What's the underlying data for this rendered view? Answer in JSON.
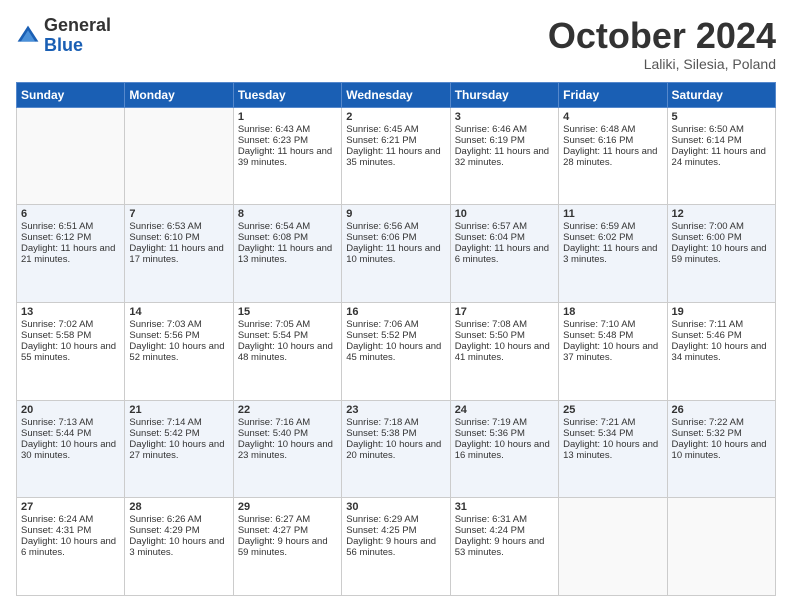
{
  "logo": {
    "general": "General",
    "blue": "Blue"
  },
  "header": {
    "month": "October 2024",
    "location": "Laliki, Silesia, Poland"
  },
  "weekdays": [
    "Sunday",
    "Monday",
    "Tuesday",
    "Wednesday",
    "Thursday",
    "Friday",
    "Saturday"
  ],
  "weeks": [
    [
      {
        "day": "",
        "sunrise": "",
        "sunset": "",
        "daylight": ""
      },
      {
        "day": "",
        "sunrise": "",
        "sunset": "",
        "daylight": ""
      },
      {
        "day": "1",
        "sunrise": "Sunrise: 6:43 AM",
        "sunset": "Sunset: 6:23 PM",
        "daylight": "Daylight: 11 hours and 39 minutes."
      },
      {
        "day": "2",
        "sunrise": "Sunrise: 6:45 AM",
        "sunset": "Sunset: 6:21 PM",
        "daylight": "Daylight: 11 hours and 35 minutes."
      },
      {
        "day": "3",
        "sunrise": "Sunrise: 6:46 AM",
        "sunset": "Sunset: 6:19 PM",
        "daylight": "Daylight: 11 hours and 32 minutes."
      },
      {
        "day": "4",
        "sunrise": "Sunrise: 6:48 AM",
        "sunset": "Sunset: 6:16 PM",
        "daylight": "Daylight: 11 hours and 28 minutes."
      },
      {
        "day": "5",
        "sunrise": "Sunrise: 6:50 AM",
        "sunset": "Sunset: 6:14 PM",
        "daylight": "Daylight: 11 hours and 24 minutes."
      }
    ],
    [
      {
        "day": "6",
        "sunrise": "Sunrise: 6:51 AM",
        "sunset": "Sunset: 6:12 PM",
        "daylight": "Daylight: 11 hours and 21 minutes."
      },
      {
        "day": "7",
        "sunrise": "Sunrise: 6:53 AM",
        "sunset": "Sunset: 6:10 PM",
        "daylight": "Daylight: 11 hours and 17 minutes."
      },
      {
        "day": "8",
        "sunrise": "Sunrise: 6:54 AM",
        "sunset": "Sunset: 6:08 PM",
        "daylight": "Daylight: 11 hours and 13 minutes."
      },
      {
        "day": "9",
        "sunrise": "Sunrise: 6:56 AM",
        "sunset": "Sunset: 6:06 PM",
        "daylight": "Daylight: 11 hours and 10 minutes."
      },
      {
        "day": "10",
        "sunrise": "Sunrise: 6:57 AM",
        "sunset": "Sunset: 6:04 PM",
        "daylight": "Daylight: 11 hours and 6 minutes."
      },
      {
        "day": "11",
        "sunrise": "Sunrise: 6:59 AM",
        "sunset": "Sunset: 6:02 PM",
        "daylight": "Daylight: 11 hours and 3 minutes."
      },
      {
        "day": "12",
        "sunrise": "Sunrise: 7:00 AM",
        "sunset": "Sunset: 6:00 PM",
        "daylight": "Daylight: 10 hours and 59 minutes."
      }
    ],
    [
      {
        "day": "13",
        "sunrise": "Sunrise: 7:02 AM",
        "sunset": "Sunset: 5:58 PM",
        "daylight": "Daylight: 10 hours and 55 minutes."
      },
      {
        "day": "14",
        "sunrise": "Sunrise: 7:03 AM",
        "sunset": "Sunset: 5:56 PM",
        "daylight": "Daylight: 10 hours and 52 minutes."
      },
      {
        "day": "15",
        "sunrise": "Sunrise: 7:05 AM",
        "sunset": "Sunset: 5:54 PM",
        "daylight": "Daylight: 10 hours and 48 minutes."
      },
      {
        "day": "16",
        "sunrise": "Sunrise: 7:06 AM",
        "sunset": "Sunset: 5:52 PM",
        "daylight": "Daylight: 10 hours and 45 minutes."
      },
      {
        "day": "17",
        "sunrise": "Sunrise: 7:08 AM",
        "sunset": "Sunset: 5:50 PM",
        "daylight": "Daylight: 10 hours and 41 minutes."
      },
      {
        "day": "18",
        "sunrise": "Sunrise: 7:10 AM",
        "sunset": "Sunset: 5:48 PM",
        "daylight": "Daylight: 10 hours and 37 minutes."
      },
      {
        "day": "19",
        "sunrise": "Sunrise: 7:11 AM",
        "sunset": "Sunset: 5:46 PM",
        "daylight": "Daylight: 10 hours and 34 minutes."
      }
    ],
    [
      {
        "day": "20",
        "sunrise": "Sunrise: 7:13 AM",
        "sunset": "Sunset: 5:44 PM",
        "daylight": "Daylight: 10 hours and 30 minutes."
      },
      {
        "day": "21",
        "sunrise": "Sunrise: 7:14 AM",
        "sunset": "Sunset: 5:42 PM",
        "daylight": "Daylight: 10 hours and 27 minutes."
      },
      {
        "day": "22",
        "sunrise": "Sunrise: 7:16 AM",
        "sunset": "Sunset: 5:40 PM",
        "daylight": "Daylight: 10 hours and 23 minutes."
      },
      {
        "day": "23",
        "sunrise": "Sunrise: 7:18 AM",
        "sunset": "Sunset: 5:38 PM",
        "daylight": "Daylight: 10 hours and 20 minutes."
      },
      {
        "day": "24",
        "sunrise": "Sunrise: 7:19 AM",
        "sunset": "Sunset: 5:36 PM",
        "daylight": "Daylight: 10 hours and 16 minutes."
      },
      {
        "day": "25",
        "sunrise": "Sunrise: 7:21 AM",
        "sunset": "Sunset: 5:34 PM",
        "daylight": "Daylight: 10 hours and 13 minutes."
      },
      {
        "day": "26",
        "sunrise": "Sunrise: 7:22 AM",
        "sunset": "Sunset: 5:32 PM",
        "daylight": "Daylight: 10 hours and 10 minutes."
      }
    ],
    [
      {
        "day": "27",
        "sunrise": "Sunrise: 6:24 AM",
        "sunset": "Sunset: 4:31 PM",
        "daylight": "Daylight: 10 hours and 6 minutes."
      },
      {
        "day": "28",
        "sunrise": "Sunrise: 6:26 AM",
        "sunset": "Sunset: 4:29 PM",
        "daylight": "Daylight: 10 hours and 3 minutes."
      },
      {
        "day": "29",
        "sunrise": "Sunrise: 6:27 AM",
        "sunset": "Sunset: 4:27 PM",
        "daylight": "Daylight: 9 hours and 59 minutes."
      },
      {
        "day": "30",
        "sunrise": "Sunrise: 6:29 AM",
        "sunset": "Sunset: 4:25 PM",
        "daylight": "Daylight: 9 hours and 56 minutes."
      },
      {
        "day": "31",
        "sunrise": "Sunrise: 6:31 AM",
        "sunset": "Sunset: 4:24 PM",
        "daylight": "Daylight: 9 hours and 53 minutes."
      },
      {
        "day": "",
        "sunrise": "",
        "sunset": "",
        "daylight": ""
      },
      {
        "day": "",
        "sunrise": "",
        "sunset": "",
        "daylight": ""
      }
    ]
  ]
}
